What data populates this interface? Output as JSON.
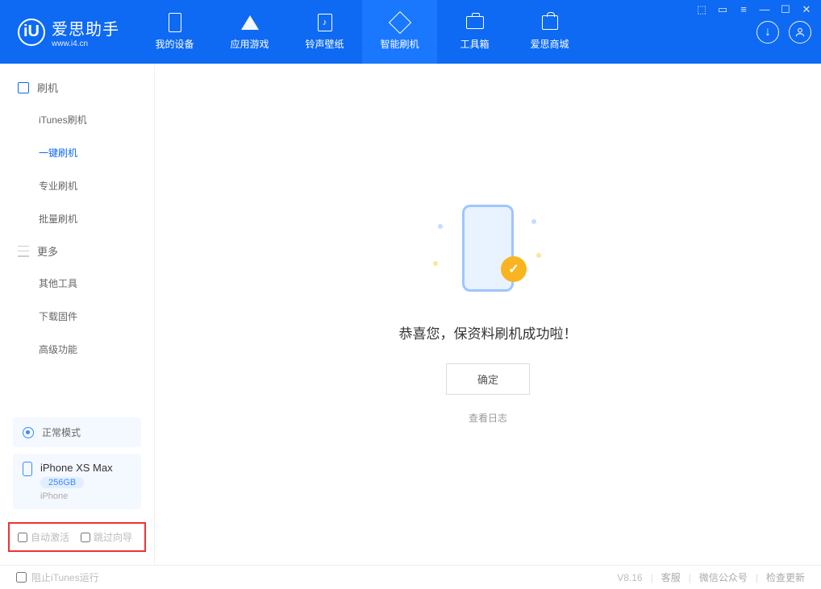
{
  "app": {
    "title": "爱思助手",
    "subtitle": "www.i4.cn"
  },
  "nav": {
    "items": [
      {
        "label": "我的设备"
      },
      {
        "label": "应用游戏"
      },
      {
        "label": "铃声壁纸"
      },
      {
        "label": "智能刷机"
      },
      {
        "label": "工具箱"
      },
      {
        "label": "爱思商城"
      }
    ]
  },
  "sidebar": {
    "group1": "刷机",
    "items1": [
      "iTunes刷机",
      "一键刷机",
      "专业刷机",
      "批量刷机"
    ],
    "group2": "更多",
    "items2": [
      "其他工具",
      "下载固件",
      "高级功能"
    ]
  },
  "device": {
    "mode": "正常模式",
    "name": "iPhone XS Max",
    "capacity": "256GB",
    "type": "iPhone"
  },
  "options": {
    "auto_activate": "自动激活",
    "skip_guide": "跳过向导"
  },
  "main": {
    "message": "恭喜您，保资料刷机成功啦！",
    "ok": "确定",
    "view_log": "查看日志"
  },
  "footer": {
    "block_itunes": "阻止iTunes运行",
    "version": "V8.16",
    "links": [
      "客服",
      "微信公众号",
      "检查更新"
    ]
  }
}
